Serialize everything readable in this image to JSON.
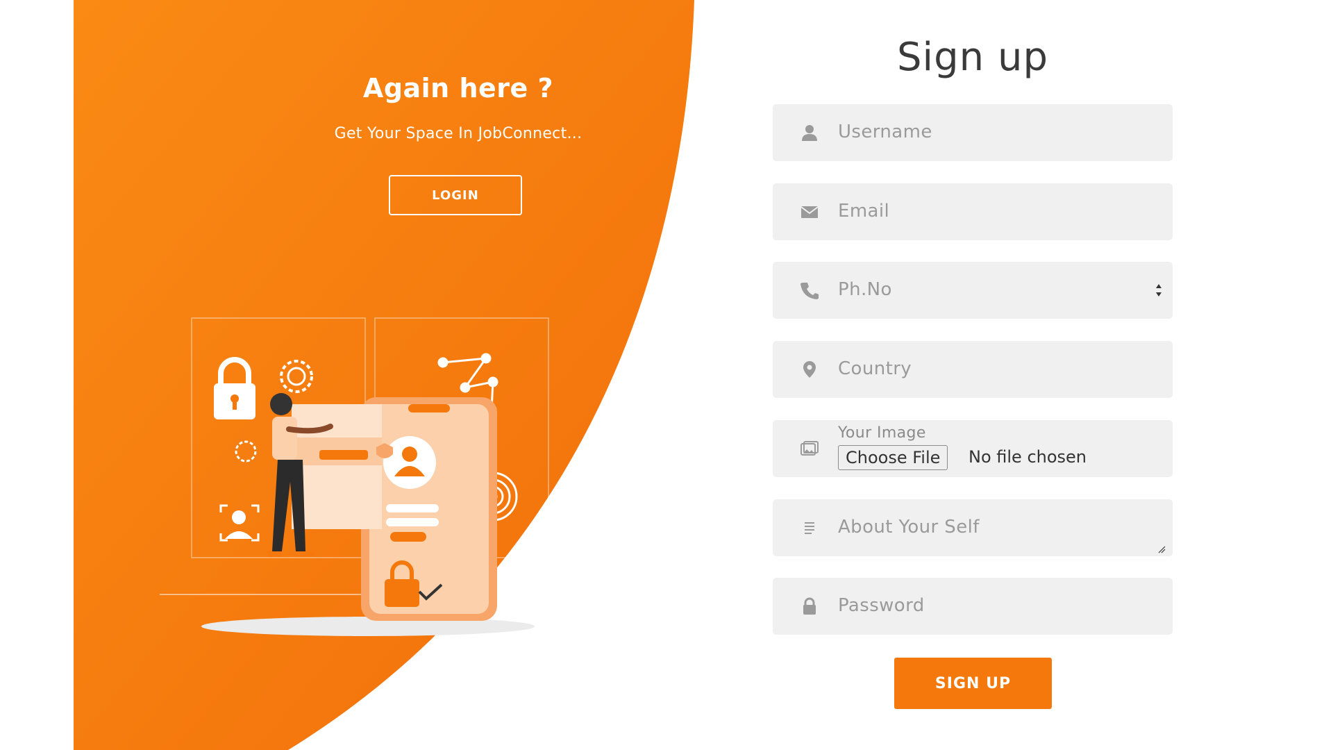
{
  "colors": {
    "accent": "#f5780c",
    "accent_light": "#fa8a18",
    "field_bg": "#f0f0f0",
    "icon_gray": "#9a9a9a"
  },
  "left": {
    "title": "Again here ?",
    "subtitle": "Get Your Space In JobConnect...",
    "login_label": "LOGIN"
  },
  "form": {
    "title": "Sign up",
    "username": {
      "placeholder": "Username",
      "icon": "user-icon"
    },
    "email": {
      "placeholder": "Email",
      "icon": "envelope-icon"
    },
    "phone": {
      "placeholder": "Ph.No",
      "icon": "phone-icon"
    },
    "country": {
      "placeholder": "Country",
      "icon": "map-pin-icon"
    },
    "image": {
      "label": "Your Image",
      "button": "Choose File",
      "status": "No file chosen",
      "icon": "image-icon"
    },
    "about": {
      "placeholder": "About Your Self",
      "icon": "text-lines-icon"
    },
    "password": {
      "placeholder": "Password",
      "icon": "lock-icon"
    },
    "submit_label": "SIGN UP"
  }
}
